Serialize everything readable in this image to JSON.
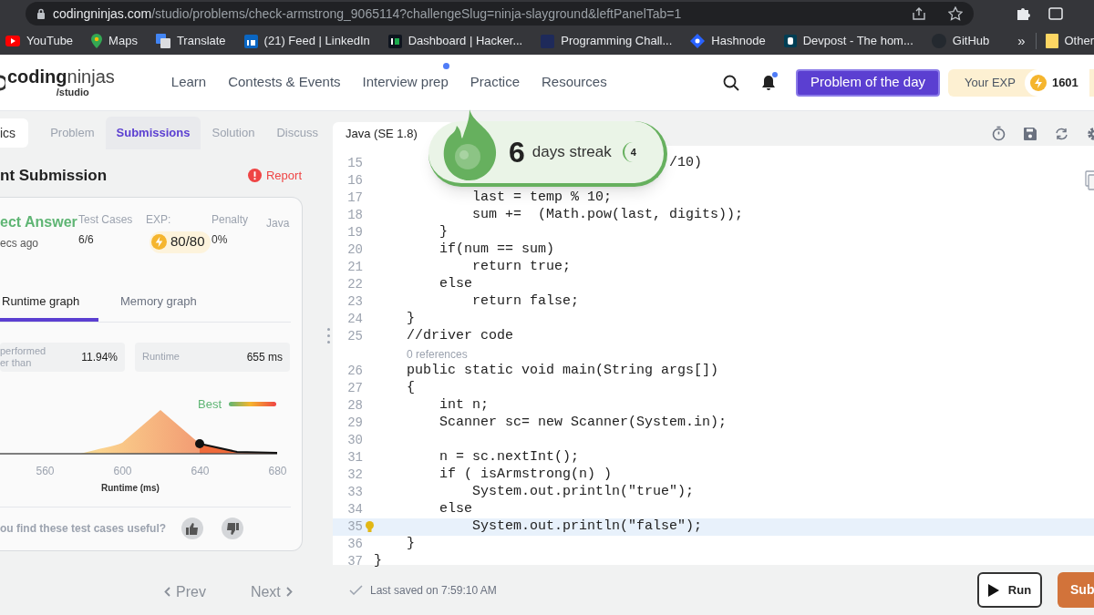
{
  "browser": {
    "url_domain": "codingninjas.com",
    "url_path": "/studio/problems/check-armstrong_9065114?challengeSlug=ninja-slayground&leftPanelTab=1",
    "bookmarks": [
      {
        "label": "YouTube",
        "kind": "play"
      },
      {
        "label": "Maps",
        "kind": "pin"
      },
      {
        "label": "Translate",
        "kind": "translate"
      },
      {
        "label": "(21) Feed | LinkedIn",
        "kind": "square"
      },
      {
        "label": "Dashboard | Hacker...",
        "kind": "dark"
      },
      {
        "label": "Programming Chall...",
        "kind": "navy"
      },
      {
        "label": "Hashnode",
        "kind": "diamond"
      },
      {
        "label": "Devpost - The hom...",
        "kind": "tile"
      },
      {
        "label": "GitHub",
        "kind": "circle"
      }
    ],
    "overflow": "»",
    "other_label": "Other"
  },
  "header": {
    "logo_bold": "coding",
    "logo_light": "ninjas",
    "logo_sub": "/studio",
    "nav": [
      {
        "label": "Learn",
        "dot": false
      },
      {
        "label": "Contests & Events",
        "dot": false
      },
      {
        "label": "Interview prep",
        "dot": true
      },
      {
        "label": "Practice",
        "dot": false
      },
      {
        "label": "Resources",
        "dot": false
      }
    ],
    "bell_dot": true,
    "cta": "Problem of the day",
    "exp": {
      "label": "Your EXP",
      "value": "1601"
    }
  },
  "left": {
    "panel_switch": {
      "label": "ics",
      "selected": true
    },
    "tabs": [
      {
        "label": "Problem",
        "selected": false
      },
      {
        "label": "Submissions",
        "selected": true
      },
      {
        "label": "Solution",
        "selected": false
      },
      {
        "label": "Discuss",
        "selected": false
      }
    ],
    "title": "nt Submission",
    "report": "Report",
    "card": {
      "status": "ect Answer",
      "time": "ecs ago",
      "stats": [
        {
          "label": "Test Cases",
          "value": "6/6",
          "kind": "plain"
        },
        {
          "label": "EXP:",
          "value": "80/80",
          "kind": "badge"
        },
        {
          "label": "Penalty",
          "value": "0%",
          "kind": "plain"
        }
      ],
      "language": "Java",
      "graph_tabs": [
        {
          "label": "Runtime graph",
          "selected": true
        },
        {
          "label": "Memory graph",
          "selected": false
        }
      ],
      "metrics": [
        {
          "label": "performed\ner than",
          "value": "11.94%"
        },
        {
          "label": "Runtime",
          "value": "655 ms"
        }
      ],
      "chart": {
        "legend": "Best",
        "ticks": [
          "560",
          "600",
          "640",
          "680"
        ],
        "axis_label": "Runtime (ms)"
      },
      "feedback": "ou find these test cases useful?"
    },
    "pager": [
      {
        "label": "Prev",
        "disabled": true
      },
      {
        "label": "Next",
        "disabled": true
      }
    ]
  },
  "editor": {
    "language": "Java (SE 1.8)",
    "lines": [
      {
        "number": "15",
        "text": "                                    /10)",
        "selected": false,
        "lightbulb": false
      },
      {
        "number": "16",
        "selected": false,
        "lightbulb": false
      },
      {
        "number": "17",
        "text": "            last = temp % 10;",
        "selected": false,
        "lightbulb": false
      },
      {
        "number": "18",
        "text": "            sum +=  (Math.pow(last, digits));",
        "selected": false,
        "lightbulb": false
      },
      {
        "number": "19",
        "text": "        }",
        "selected": false,
        "lightbulb": false
      },
      {
        "number": "20",
        "text": "        if(num == sum)",
        "selected": false,
        "lightbulb": false
      },
      {
        "number": "21",
        "text": "            return true;",
        "selected": false,
        "lightbulb": false
      },
      {
        "number": "22",
        "text": "        else",
        "selected": false,
        "lightbulb": false
      },
      {
        "number": "23",
        "text": "            return false;",
        "selected": false,
        "lightbulb": false
      },
      {
        "number": "24",
        "text": "    }",
        "selected": false,
        "lightbulb": false
      },
      {
        "number": "25",
        "text": "    //driver code",
        "selected": false,
        "lightbulb": false
      },
      {
        "kind": "codelens",
        "text": "    0 references"
      },
      {
        "number": "26",
        "text": "    public static void main(String args[])",
        "selected": false,
        "lightbulb": false
      },
      {
        "number": "27",
        "text": "    {",
        "selected": false,
        "lightbulb": false
      },
      {
        "number": "28",
        "text": "        int n;",
        "selected": false,
        "lightbulb": false
      },
      {
        "number": "29",
        "text": "        Scanner sc= new Scanner(System.in);",
        "selected": false,
        "lightbulb": false
      },
      {
        "number": "30",
        "selected": false,
        "lightbulb": false
      },
      {
        "number": "31",
        "text": "        n = sc.nextInt();",
        "selected": false,
        "lightbulb": false
      },
      {
        "number": "32",
        "text": "        if ( isArmstrong(n) )",
        "selected": false,
        "lightbulb": false
      },
      {
        "number": "33",
        "text": "            System.out.println(\"true\");",
        "selected": false,
        "lightbulb": false
      },
      {
        "number": "34",
        "text": "        else",
        "selected": false,
        "lightbulb": false
      },
      {
        "number": "35",
        "text": "            System.out.println(\"false\");",
        "selected": true,
        "lightbulb": true
      },
      {
        "number": "36",
        "text": "    }",
        "selected": false,
        "lightbulb": false
      },
      {
        "number": "37",
        "text": "}",
        "selected": false,
        "lightbulb": false
      }
    ],
    "streak": {
      "count": "6",
      "label": "days streak",
      "ring": "4"
    },
    "saved": "Last saved on 7:59:10 AM",
    "run": "Run",
    "submit": "Sub"
  }
}
